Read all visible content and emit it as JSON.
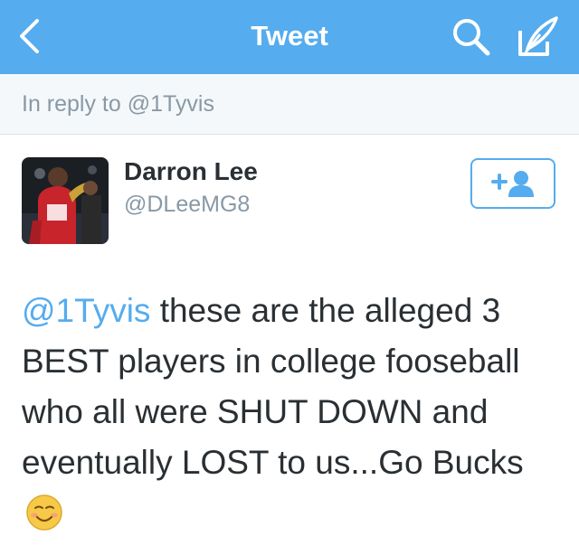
{
  "nav": {
    "title": "Tweet",
    "back_icon": "chevron-left-icon",
    "search_icon": "search-icon",
    "compose_icon": "compose-feather-icon",
    "bar_color": "#55acee"
  },
  "reply": {
    "text": "In reply to @1Tyvis"
  },
  "author": {
    "name": "Darron Lee",
    "handle": "@DLeeMG8",
    "follow_icon": "add-user-icon"
  },
  "tweet": {
    "mention": "@1Tyvis",
    "body": " these are the alleged 3 BEST players in college fooseball who all were SHUT DOWN and eventually LOST to us...Go Bucks",
    "emoji": "smiling-face-icon",
    "link_color": "#55acee"
  }
}
